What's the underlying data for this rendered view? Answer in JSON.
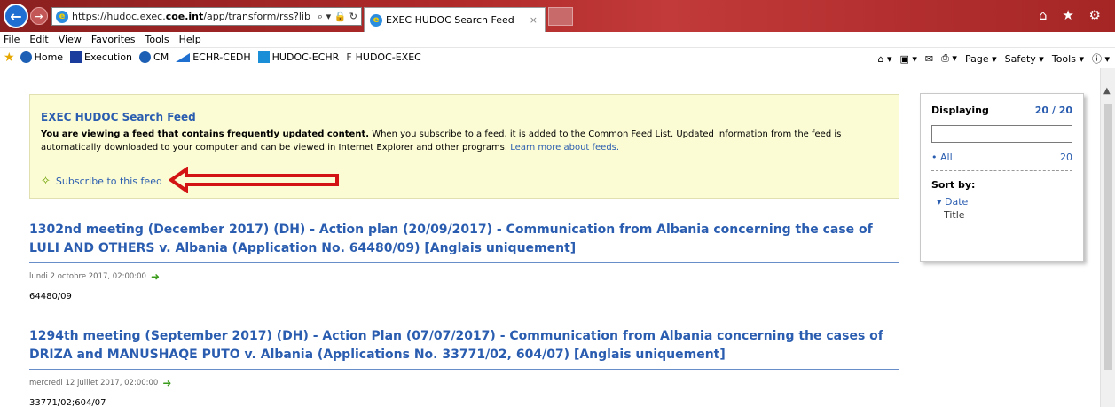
{
  "browser": {
    "address_url_host": "https://hudoc.exec.",
    "address_url_domain": "coe.int",
    "address_url_path": "/app/transform/rss?lib",
    "address_controls": "⌕ ▾ 🔒 ↻",
    "tab_title": "EXEC HUDOC Search Feed",
    "tab_close": "×",
    "window_icons": "⌂ ★ ⚙"
  },
  "menu": [
    "File",
    "Edit",
    "View",
    "Favorites",
    "Tools",
    "Help"
  ],
  "favorites": [
    {
      "label": "Home",
      "icon": "globe-icon",
      "color": "#1c5fb5"
    },
    {
      "label": "Execution",
      "icon": "stars-icon",
      "color": "#1a3c9c"
    },
    {
      "label": "CM",
      "icon": "globe-icon",
      "color": "#1c5fb5"
    },
    {
      "label": "ECHR-CEDH",
      "icon": "triangle-icon",
      "color": "#1f6fd0"
    },
    {
      "label": "HUDOC-ECHR",
      "icon": "hudoc-icon",
      "color": "#1a8fd8"
    },
    {
      "label": "HUDOC-EXEC",
      "icon": "bracket-icon",
      "color": "#333"
    }
  ],
  "commandbar": {
    "home": "⌂ ▾",
    "feeds": "▣ ▾",
    "mail": "✉",
    "print": "⎙ ▾",
    "page": "Page ▾",
    "safety": "Safety ▾",
    "tools": "Tools ▾",
    "help": "ⓘ ▾"
  },
  "infobox": {
    "title": "EXEC HUDOC Search Feed",
    "desc_bold": "You are viewing a feed that contains frequently updated content.",
    "desc_text": " When you subscribe to a feed, it is added to the Common Feed List. Updated information from the feed is automatically downloaded to your computer and can be viewed in Internet Explorer and other programs. ",
    "learn_more": "Learn more about feeds.",
    "subscribe_label": "Subscribe to this feed"
  },
  "items": [
    {
      "title": "1302nd meeting (December 2017) (DH) - Action plan (20/09/2017) - Communication from Albania concerning the case of LULI AND OTHERS v. Albania (Application No. 64480/09) [Anglais uniquement]",
      "date": "lundi 2 octobre 2017, 02:00:00",
      "desc": "64480/09"
    },
    {
      "title": "1294th meeting (September 2017) (DH) - Action Plan (07/07/2017) - Communication from Albania concerning the cases of DRIZA and MANUSHAQE PUTO v. Albania (Applications No. 33771/02, 604/07) [Anglais uniquement]",
      "date": "mercredi 12 juillet 2017, 02:00:00",
      "desc": "33771/02;604/07"
    }
  ],
  "sidepanel": {
    "displaying_label": "Displaying",
    "displaying_count": "20 / 20",
    "all_label": "All",
    "all_count": "20",
    "sortby_label": "Sort by:",
    "sort_date": "Date",
    "sort_title": "Title"
  }
}
